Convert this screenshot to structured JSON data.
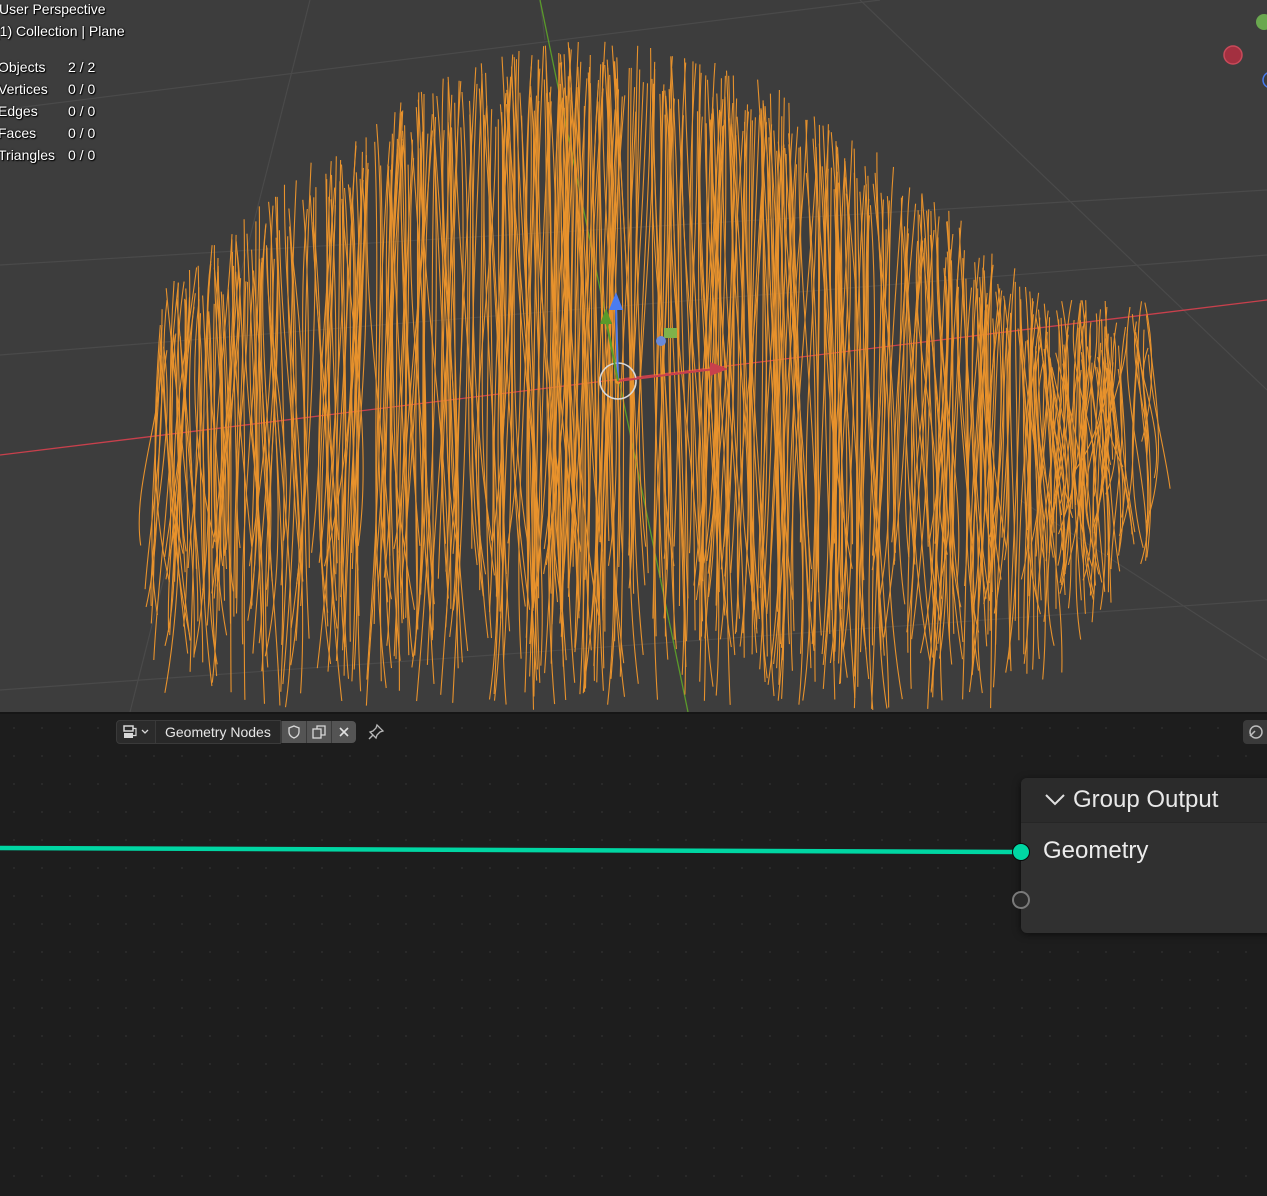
{
  "viewport": {
    "view_name": "User Perspective",
    "collection_line": "(1) Collection | Plane",
    "stats": [
      {
        "label": "Objects",
        "value": "2 / 2"
      },
      {
        "label": "Vertices",
        "value": "0 / 0"
      },
      {
        "label": "Edges",
        "value": "0 / 0"
      },
      {
        "label": "Faces",
        "value": "0 / 0"
      },
      {
        "label": "Triangles",
        "value": "0 / 0"
      }
    ],
    "colors": {
      "background": "#3d3d3d",
      "hair": "#e8922c",
      "x_axis": "#c8404c",
      "y_axis": "#5a9a2a",
      "z_axis": "#4a7cf0"
    }
  },
  "node_editor": {
    "editor_type_icon": "node-editor-icon",
    "tree_name": "Geometry Nodes",
    "buttons": [
      "fake-user-shield-icon",
      "duplicate-icon",
      "close-icon"
    ],
    "pin_icon": "pin-icon",
    "link_color": "#00d6a3",
    "group_output": {
      "title": "Group Output",
      "socket_label": "Geometry"
    }
  }
}
